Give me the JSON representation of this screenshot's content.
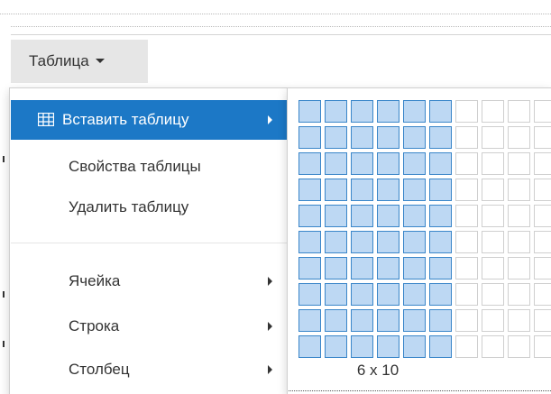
{
  "menubar": {
    "table_menu_label": "Таблица"
  },
  "dropdown": {
    "items": [
      {
        "label": "Вставить таблицу",
        "icon": "table-icon",
        "submenu": true,
        "active": true
      },
      {
        "label": "Свойства таблицы",
        "submenu": false,
        "active": false
      },
      {
        "label": "Удалить таблицу",
        "submenu": false,
        "active": false
      },
      {
        "label": "Ячейка",
        "submenu": true,
        "active": false
      },
      {
        "label": "Строка",
        "submenu": true,
        "active": false
      },
      {
        "label": "Столбец",
        "submenu": true,
        "active": false
      }
    ]
  },
  "grid_picker": {
    "size_label": "6 x 10",
    "selected_cols": 6,
    "selected_rows": 10,
    "total_cols": 10,
    "total_rows": 10
  },
  "colors": {
    "active_item_bg": "#1c78c6",
    "grid_selected_fill": "#bdd8f3",
    "grid_selected_border": "#3a86c9",
    "menu_button_bg": "#e6e6e6"
  }
}
